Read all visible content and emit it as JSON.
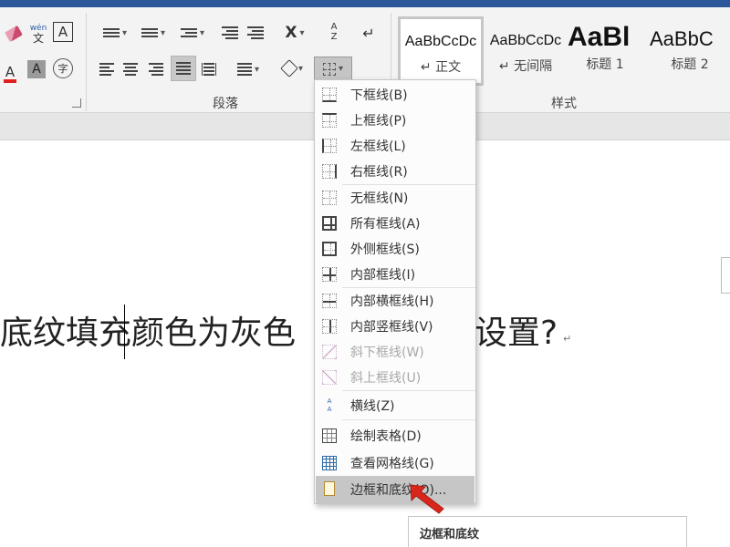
{
  "ribbon": {
    "font_group": {
      "clear_format_icon": "eraser-icon",
      "phonetic_icon": "phonetic-guide-icon",
      "phonetic_top": "wén",
      "phonetic_bottom": "文",
      "char_border_label": "A",
      "font_color_label": "A",
      "char_shading_label": "A",
      "enclose_char_label": "字"
    },
    "paragraph_group": {
      "label": "段落",
      "sort_label": "A\nZ"
    },
    "styles_group": {
      "label": "样式",
      "tiles": [
        {
          "sample": "AaBbCcDc",
          "name": "↵ 正文"
        },
        {
          "sample": "AaBbCcDc",
          "name": "↵ 无间隔"
        },
        {
          "sample": "AaBl",
          "name": "标题 1"
        },
        {
          "sample": "AaBbC",
          "name": "标题 2"
        }
      ]
    }
  },
  "document": {
    "text_left": "底纹填充颜色为灰色",
    "text_right": "设置?",
    "paragraph_mark": "↵"
  },
  "border_menu": {
    "items": [
      {
        "label": "下框线(B)",
        "disabled": false
      },
      {
        "label": "上框线(P)",
        "disabled": false
      },
      {
        "label": "左框线(L)",
        "disabled": false
      },
      {
        "label": "右框线(R)",
        "disabled": false
      },
      {
        "label": "无框线(N)",
        "disabled": false
      },
      {
        "label": "所有框线(A)",
        "disabled": false
      },
      {
        "label": "外侧框线(S)",
        "disabled": false
      },
      {
        "label": "内部框线(I)",
        "disabled": false
      },
      {
        "label": "内部横框线(H)",
        "disabled": false
      },
      {
        "label": "内部竖框线(V)",
        "disabled": false
      },
      {
        "label": "斜下框线(W)",
        "disabled": true
      },
      {
        "label": "斜上框线(U)",
        "disabled": true
      },
      {
        "label": "横线(Z)",
        "disabled": false
      },
      {
        "label": "绘制表格(D)",
        "disabled": false
      },
      {
        "label": "查看网格线(G)",
        "disabled": false
      },
      {
        "label": "边框和底纹(O)...",
        "disabled": false,
        "highlighted": true
      }
    ]
  },
  "dialog": {
    "title": "边框和底纹"
  },
  "colors": {
    "title_bar": "#2b579a",
    "ribbon_bg": "#f3f3f3",
    "menu_highlight": "#c6c6c6",
    "arrow": "#d9261c",
    "font_color_bar": "#e02020"
  }
}
